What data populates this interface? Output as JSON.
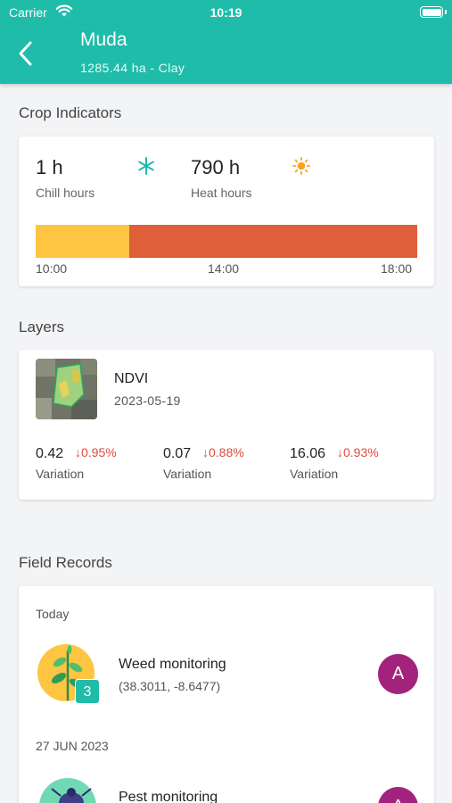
{
  "status_bar": {
    "carrier": "Carrier",
    "time": "10:19"
  },
  "header": {
    "title": "Muda",
    "subtitle": "1285.44 ha - Clay"
  },
  "crop_indicators": {
    "section_title": "Crop Indicators",
    "chill": {
      "value": "1 h",
      "label": "Chill hours",
      "icon": "snowflake-icon"
    },
    "heat": {
      "value": "790 h",
      "label": "Heat hours",
      "icon": "sun-icon"
    },
    "timeline_ticks": [
      "10:00",
      "14:00",
      "18:00"
    ],
    "timeline_colors": {
      "chill": "#fec543",
      "heat": "#de5f3a"
    }
  },
  "layers": {
    "section_title": "Layers",
    "layer": {
      "name": "NDVI",
      "date": "2023-05-19"
    },
    "metrics": [
      {
        "value": "0.42",
        "delta": "0.95%",
        "label": "Variation"
      },
      {
        "value": "0.07",
        "delta": "0.88%",
        "label": "Variation"
      },
      {
        "value": "16.06",
        "delta": "0.93%",
        "label": "Variation"
      }
    ]
  },
  "field_records": {
    "section_title": "Field Records",
    "groups": [
      {
        "date": "Today",
        "record": {
          "title": "Weed monitoring",
          "coords": "(38.3011, -8.6477)",
          "badge": "3",
          "avatar": "A"
        }
      },
      {
        "date": "27 JUN 2023",
        "record": {
          "title": "Pest monitoring",
          "avatar": "A"
        }
      }
    ]
  },
  "colors": {
    "primary": "#1fbcaa",
    "negative": "#de4b3e",
    "avatar": "#a2237c"
  }
}
